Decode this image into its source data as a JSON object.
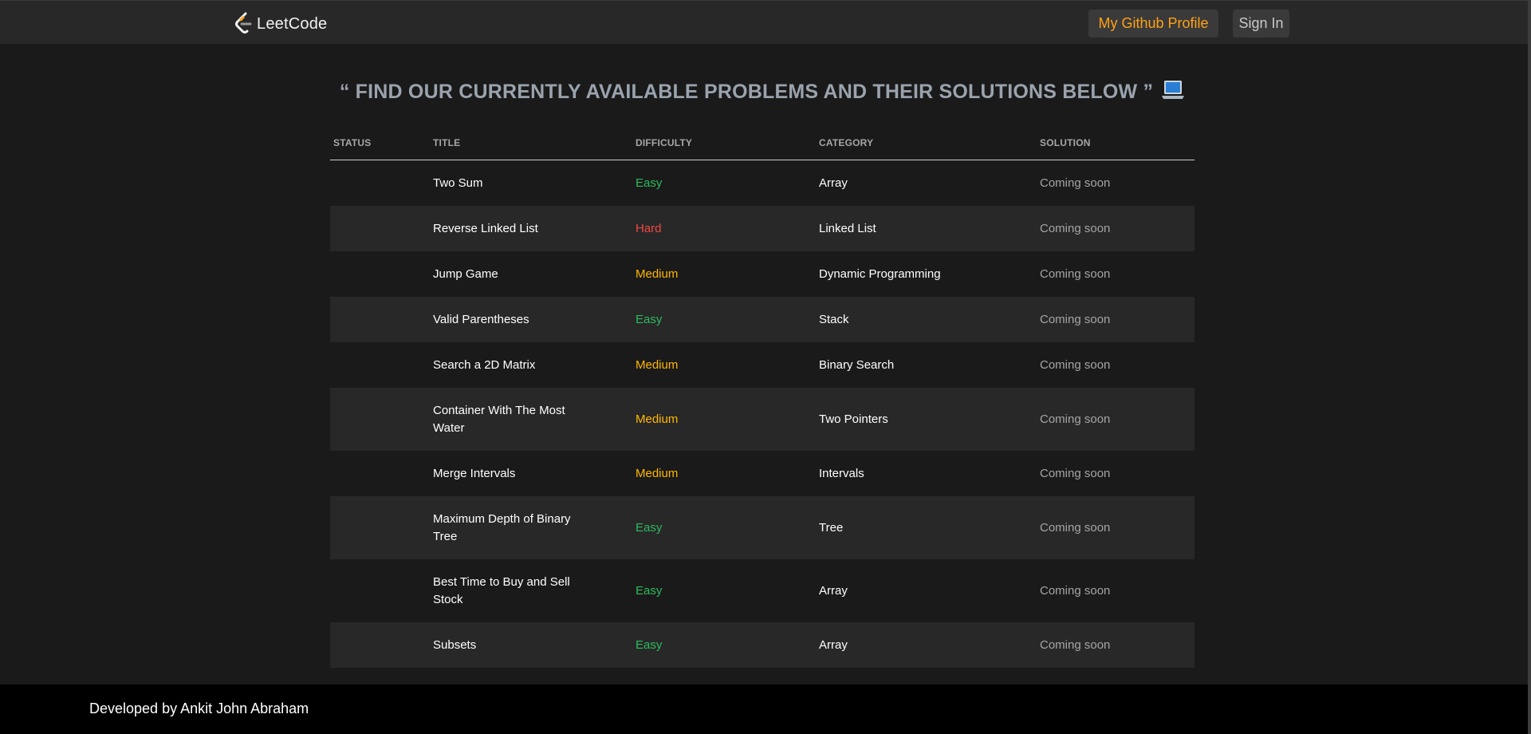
{
  "navbar": {
    "logo_text": "LeetCode",
    "github_label": "My Github Profile",
    "signin_label": "Sign In"
  },
  "heading": {
    "text": "“ FIND OUR CURRENTLY AVAILABLE PROBLEMS AND THEIR SOLUTIONS BELOW ”",
    "icon": "laptop-icon"
  },
  "table": {
    "headers": {
      "status": "STATUS",
      "title": "TITLE",
      "difficulty": "DIFFICULTY",
      "category": "CATEGORY",
      "solution": "SOLUTION"
    },
    "rows": [
      {
        "status": "",
        "title": "Two Sum",
        "difficulty": "Easy",
        "category": "Array",
        "solution": "Coming soon"
      },
      {
        "status": "",
        "title": "Reverse Linked List",
        "difficulty": "Hard",
        "category": "Linked List",
        "solution": "Coming soon"
      },
      {
        "status": "",
        "title": "Jump Game",
        "difficulty": "Medium",
        "category": "Dynamic Programming",
        "solution": "Coming soon"
      },
      {
        "status": "",
        "title": "Valid Parentheses",
        "difficulty": "Easy",
        "category": "Stack",
        "solution": "Coming soon"
      },
      {
        "status": "",
        "title": "Search a 2D Matrix",
        "difficulty": "Medium",
        "category": "Binary Search",
        "solution": "Coming soon"
      },
      {
        "status": "",
        "title": "Container With The Most Water",
        "difficulty": "Medium",
        "category": "Two Pointers",
        "solution": "Coming soon"
      },
      {
        "status": "",
        "title": "Merge Intervals",
        "difficulty": "Medium",
        "category": "Intervals",
        "solution": "Coming soon"
      },
      {
        "status": "",
        "title": "Maximum Depth of Binary Tree",
        "difficulty": "Easy",
        "category": "Tree",
        "solution": "Coming soon"
      },
      {
        "status": "",
        "title": "Best Time to Buy and Sell Stock",
        "difficulty": "Easy",
        "category": "Array",
        "solution": "Coming soon"
      },
      {
        "status": "",
        "title": "Subsets",
        "difficulty": "Easy",
        "category": "Array",
        "solution": "Coming soon"
      }
    ]
  },
  "colors": {
    "accent": "#ffa116",
    "easy": "#2cbb5d",
    "medium": "#ffb800",
    "hard": "#ef4743",
    "background": "#1a1a1a",
    "navbar": "#282828"
  },
  "footer": {
    "text": "Developed by Ankit John Abraham"
  }
}
